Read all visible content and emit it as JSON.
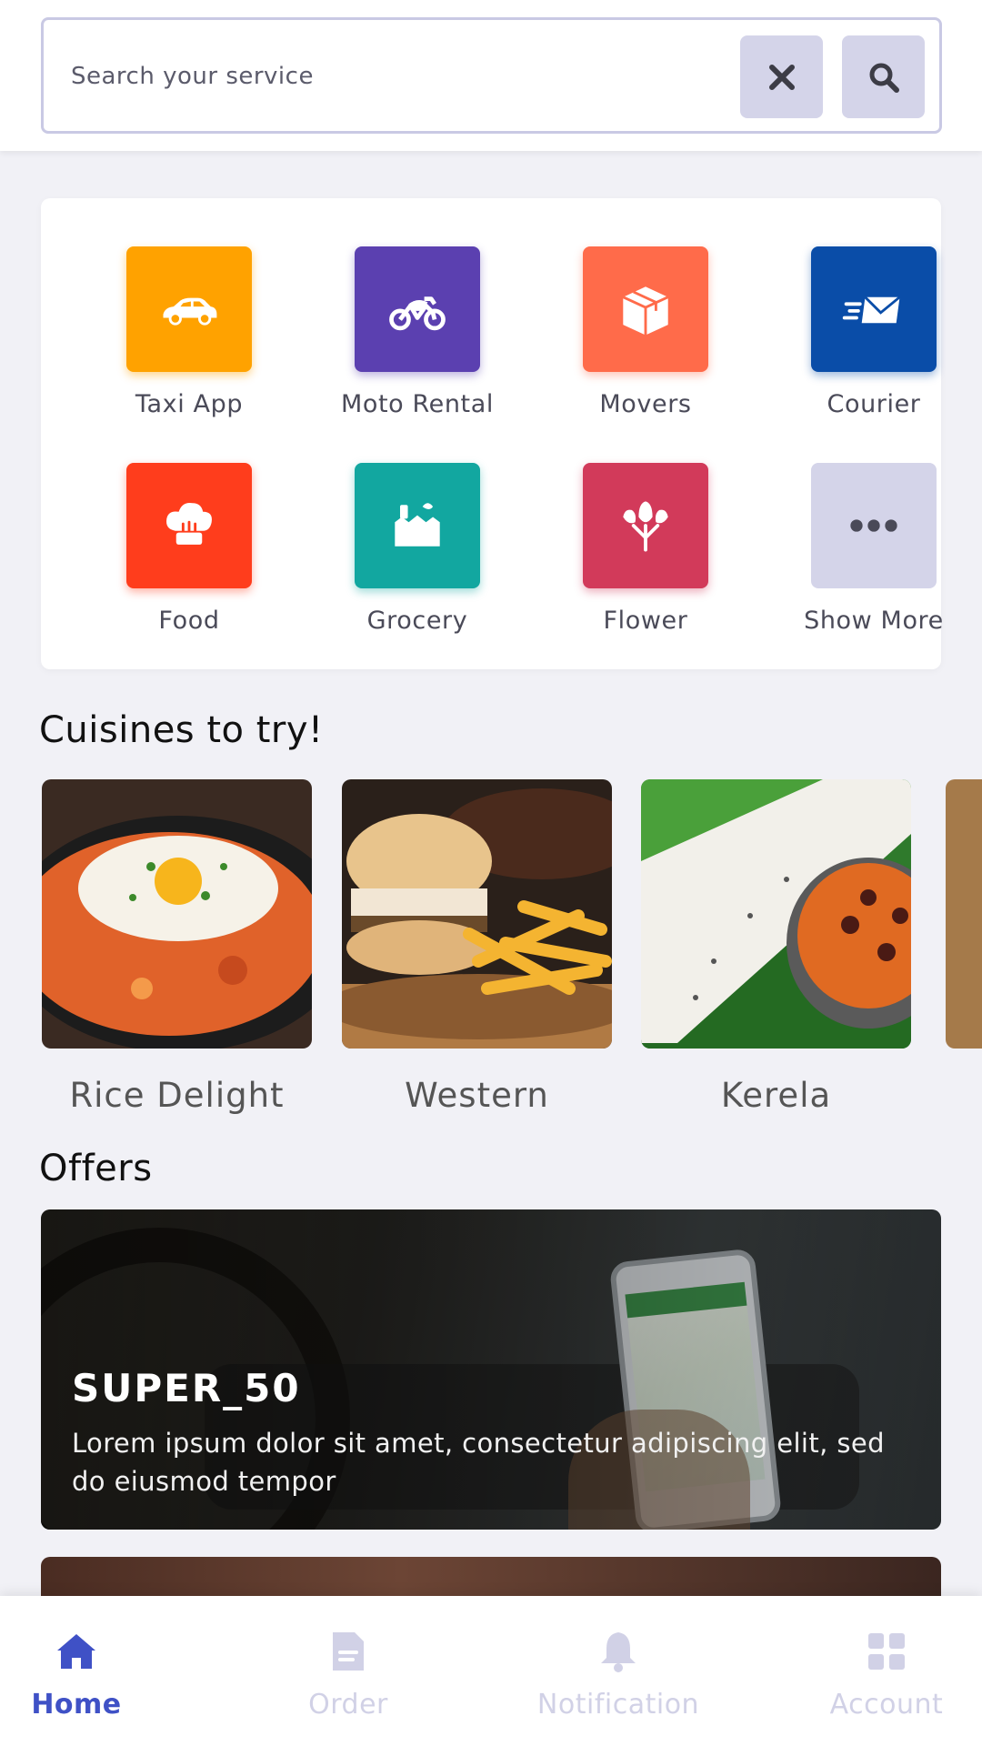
{
  "search": {
    "placeholder": "Search your service"
  },
  "services": [
    {
      "label": "Taxi App",
      "icon": "car-icon",
      "color": "#FFA200"
    },
    {
      "label": "Moto Rental",
      "icon": "motorbike-icon",
      "color": "#5B40B0"
    },
    {
      "label": "Movers",
      "icon": "box-icon",
      "color": "#FF6B4A"
    },
    {
      "label": "Courier",
      "icon": "envelope-icon",
      "color": "#0A4DA8"
    },
    {
      "label": "Food",
      "icon": "chef-hat-icon",
      "color": "#FF3D1C"
    },
    {
      "label": "Grocery",
      "icon": "grocery-bag-icon",
      "color": "#12A7A0"
    },
    {
      "label": "Flower",
      "icon": "flower-icon",
      "color": "#D23A5A"
    },
    {
      "label": "Show More",
      "icon": "more-dots-icon",
      "color": "#D4D4E9"
    }
  ],
  "cuisines": {
    "title": "Cuisines to try!",
    "items": [
      {
        "label": "Rice Delight"
      },
      {
        "label": "Western"
      },
      {
        "label": "Kerela"
      }
    ]
  },
  "offers": {
    "title": "Offers",
    "items": [
      {
        "code": "SUPER_50",
        "description": "Lorem ipsum dolor sit amet, consectetur adipiscing elit, sed do eiusmod tempor"
      }
    ]
  },
  "nav": {
    "items": [
      {
        "label": "Home",
        "icon": "home-icon",
        "active": true
      },
      {
        "label": "Order",
        "icon": "order-icon",
        "active": false
      },
      {
        "label": "Notification",
        "icon": "bell-icon",
        "active": false
      },
      {
        "label": "Account",
        "icon": "grid-icon",
        "active": false
      }
    ]
  },
  "colors": {
    "accent": "#3F51C6",
    "nav_inactive": "#D1D1E6",
    "background": "#F1F1F6"
  }
}
